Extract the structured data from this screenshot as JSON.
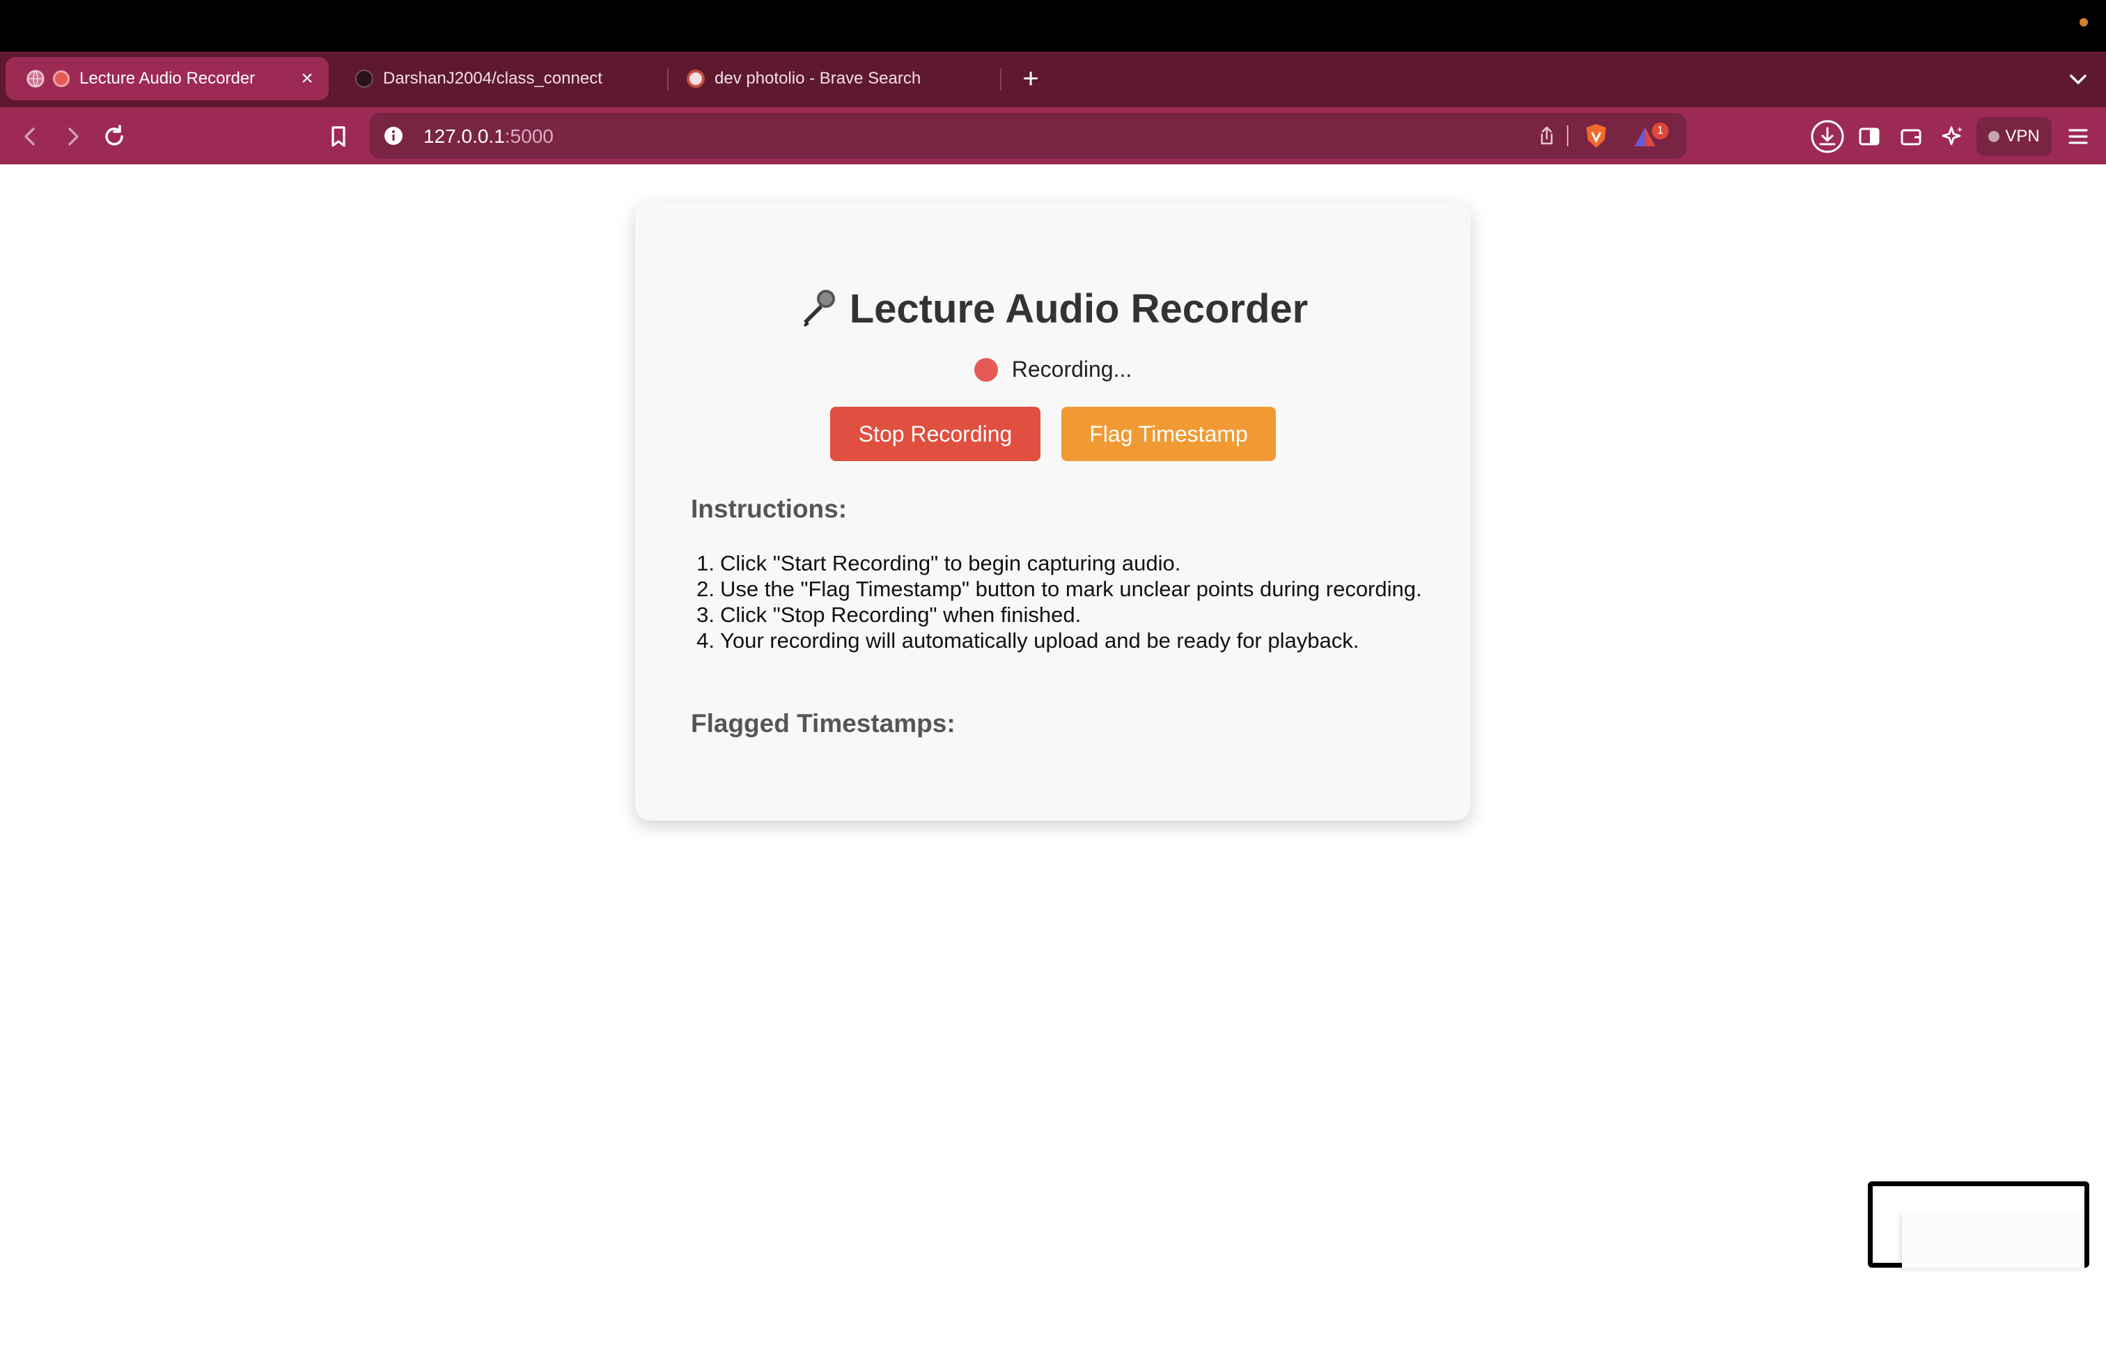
{
  "browser": {
    "tabs": [
      {
        "label": "Lecture Audio Recorder",
        "active": true,
        "icon": "globe-icon"
      },
      {
        "label": "DarshanJ2004/class_connect",
        "active": false,
        "icon": "github-icon"
      },
      {
        "label": "dev photolio - Brave Search",
        "active": false,
        "icon": "brave-search-icon"
      }
    ],
    "close_glyph": "×",
    "new_tab_glyph": "+",
    "url_host": "127.0.0.1",
    "url_port": ":5000",
    "notification_count": "1",
    "vpn_label": "VPN",
    "colors": {
      "tab_strip": "#5e1830",
      "toolbar": "#9c2a55",
      "url_bar": "#7a2444"
    }
  },
  "app": {
    "title": "Lecture Audio Recorder",
    "title_icon": "microphone-icon",
    "status": "Recording...",
    "status_color": "#e65a56",
    "stop_button": "Stop Recording",
    "flag_button": "Flag Timestamp",
    "stop_color": "#e04f3f",
    "flag_color": "#f19a33",
    "instructions_heading": "Instructions:",
    "instructions": [
      {
        "num": "1.",
        "text": "Click \"Start Recording\" to begin capturing audio."
      },
      {
        "num": "2.",
        "text": "Use the \"Flag Timestamp\" button to mark unclear points during recording."
      },
      {
        "num": "3.",
        "text": "Click \"Stop Recording\" when finished."
      },
      {
        "num": "4.",
        "text": "Your recording will automatically upload and be ready for playback."
      }
    ],
    "flagged_heading": "Flagged Timestamps:"
  }
}
